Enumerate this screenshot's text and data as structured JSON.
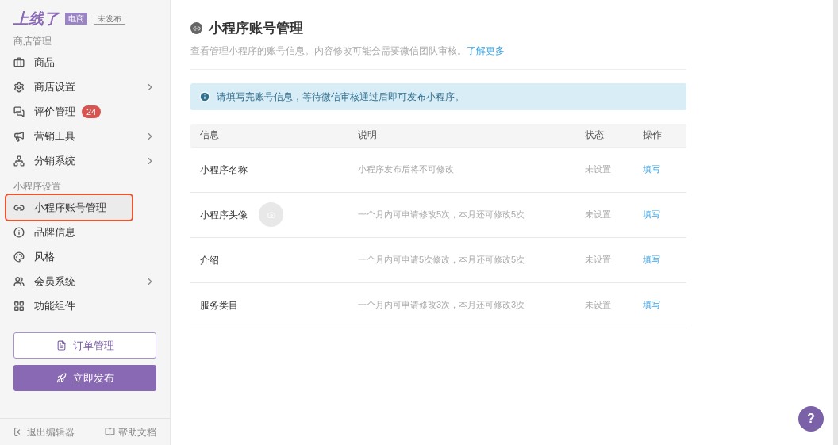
{
  "sidebar": {
    "logo": "上线了",
    "tags": [
      "电商",
      "未发布"
    ],
    "sections": [
      {
        "title": "商店管理",
        "items": [
          {
            "label": "商品",
            "selected": false,
            "expandable": false
          },
          {
            "label": "商店设置",
            "selected": false,
            "expandable": true
          },
          {
            "label": "评价管理",
            "selected": false,
            "expandable": false,
            "badge": "24"
          },
          {
            "label": "营销工具",
            "selected": false,
            "expandable": true
          },
          {
            "label": "分销系统",
            "selected": false,
            "expandable": true
          }
        ]
      },
      {
        "title": "小程序设置",
        "items": [
          {
            "label": "小程序账号管理",
            "selected": true,
            "expandable": false
          },
          {
            "label": "品牌信息",
            "selected": false,
            "expandable": false
          },
          {
            "label": "风格",
            "selected": false,
            "expandable": false
          },
          {
            "label": "会员系统",
            "selected": false,
            "expandable": true
          },
          {
            "label": "功能组件",
            "selected": false,
            "expandable": false
          }
        ]
      }
    ],
    "order_button": "订单管理",
    "publish_button": "立即发布",
    "footer": [
      "退出编辑器",
      "帮助文档"
    ]
  },
  "page": {
    "title": "小程序账号管理",
    "subtitle": "查看管理小程序的账号信息。内容修改可能会需要微信团队审核。",
    "learn_more": "了解更多",
    "alert": "请填写完账号信息，等待微信审核通过后即可发布小程序。",
    "table": {
      "columns": [
        "信息",
        "说明",
        "状态",
        "操作"
      ],
      "rows": [
        {
          "info": "小程序名称",
          "note": "小程序发布后将不可修改",
          "status": "未设置",
          "action": "填写"
        },
        {
          "info": "小程序头像",
          "kind": "avatar",
          "note": "一个月内可申请修改5次，本月还可修改5次",
          "status": "未设置",
          "action": "填写"
        },
        {
          "info": "介绍",
          "note": "一个月内可申请5次修改，本月还可修改5次",
          "status": "未设置",
          "action": "填写"
        },
        {
          "info": "服务类目",
          "note": "一个月内可申请修改3次，本月还可修改3次",
          "status": "未设置",
          "action": "填写"
        }
      ]
    }
  },
  "help_button": "?"
}
